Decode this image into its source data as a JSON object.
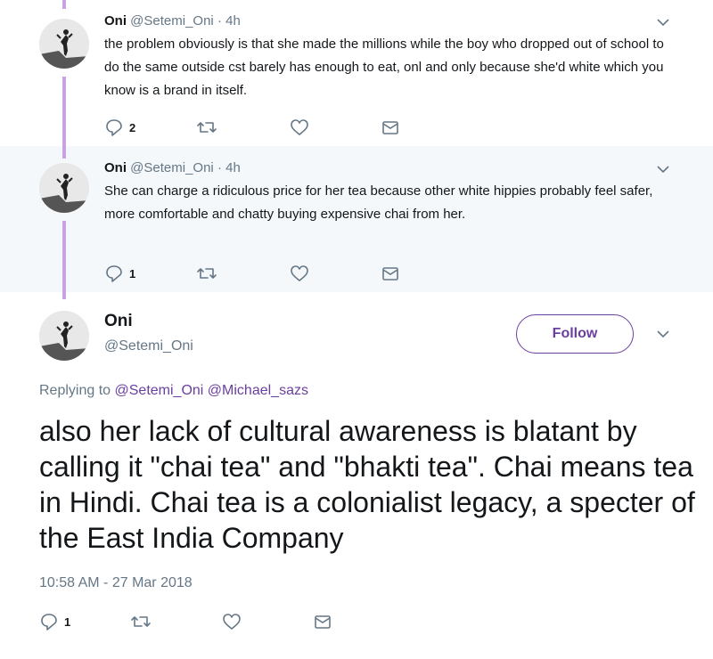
{
  "replies": [
    {
      "name": "Oni",
      "handle": "@Setemi_Oni",
      "time": "· 4h",
      "text": "the problem obviously is that she made the millions while the boy who dropped out of school to do the same outside cst barely has enough to eat, onl and only because she'd white which you know is a brand in itself.",
      "reply_count": "2",
      "icons": [
        "reply-icon",
        "retweet-icon",
        "like-icon",
        "message-icon"
      ]
    },
    {
      "name": "Oni",
      "handle": "@Setemi_Oni",
      "time": "· 4h",
      "text": "She can charge a ridiculous price for her tea because other white hippies probably feel safer, more comfortable and chatty buying expensive chai from her.",
      "reply_count": "1",
      "icons": [
        "reply-icon",
        "retweet-icon",
        "like-icon",
        "message-icon"
      ]
    }
  ],
  "main": {
    "name": "Oni",
    "handle": "@Setemi_Oni",
    "follow_label": "Follow",
    "replying_prefix": "Replying to",
    "replying_to": [
      "@Setemi_Oni",
      "@Michael_sazs"
    ],
    "text": "also her lack of cultural awareness is blatant by calling it \"chai tea\" and \"bhakti tea\". Chai means tea in Hindi. Chai tea is a colonialist legacy, a specter of the East India Company",
    "timestamp": "10:58 AM - 27 Mar 2018",
    "reply_count": "1"
  },
  "colors": {
    "accent": "#6b3fa0",
    "thread_line": "#c7a4e0",
    "muted": "#657786",
    "alt_background": "#f5f8fa"
  }
}
